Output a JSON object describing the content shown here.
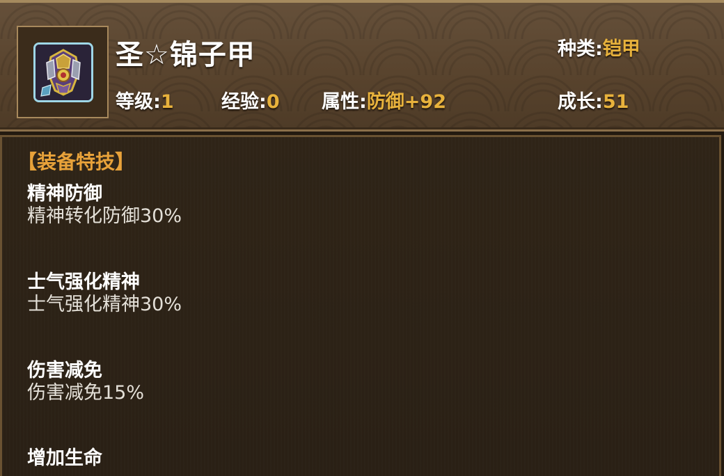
{
  "item": {
    "title": "圣☆锦子甲",
    "icon": "armor-icon"
  },
  "stats": {
    "type_label": "种类:",
    "type_value": "铠甲",
    "level_label": "等级:",
    "level_value": "1",
    "exp_label": "经验:",
    "exp_value": "0",
    "attr_label": "属性:",
    "attr_value": "防御+92",
    "growth_label": "成长:",
    "growth_value": "51"
  },
  "section": {
    "title": "【装备特技】"
  },
  "skills": [
    {
      "name": "精神防御",
      "desc": "精神转化防御30%"
    },
    {
      "name": "士气强化精神",
      "desc": "士气强化精神30%"
    },
    {
      "name": "伤害减免",
      "desc": "伤害减免15%"
    },
    {
      "name": "增加生命",
      "desc": ""
    }
  ],
  "colors": {
    "accent": "#e8b23c",
    "section": "#e8a23a",
    "text": "#ffffff"
  }
}
